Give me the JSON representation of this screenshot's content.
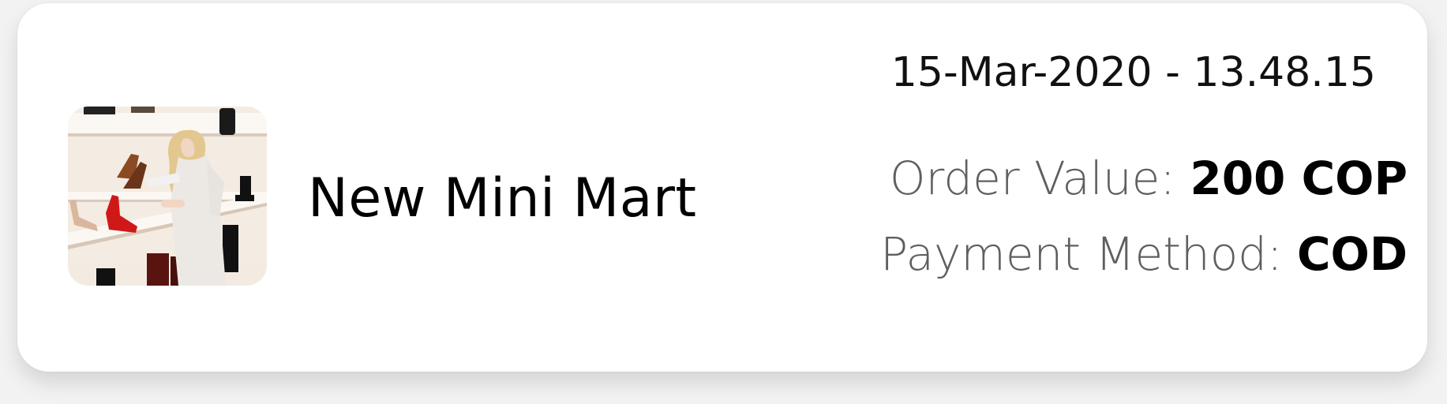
{
  "store": {
    "name": "New Mini Mart",
    "image_icon": "store-photo-shoe-shelf"
  },
  "order": {
    "timestamp": "15-Mar-2020 - 13.48.15",
    "value_label": "Order Value: ",
    "value": "200 COP",
    "payment_label": "Payment Method: ",
    "payment_method": "COD"
  },
  "colors": {
    "card_background": "#ffffff",
    "page_background": "#f2f2f2",
    "label_gray": "#5f5f5f",
    "text_black": "#000000"
  }
}
